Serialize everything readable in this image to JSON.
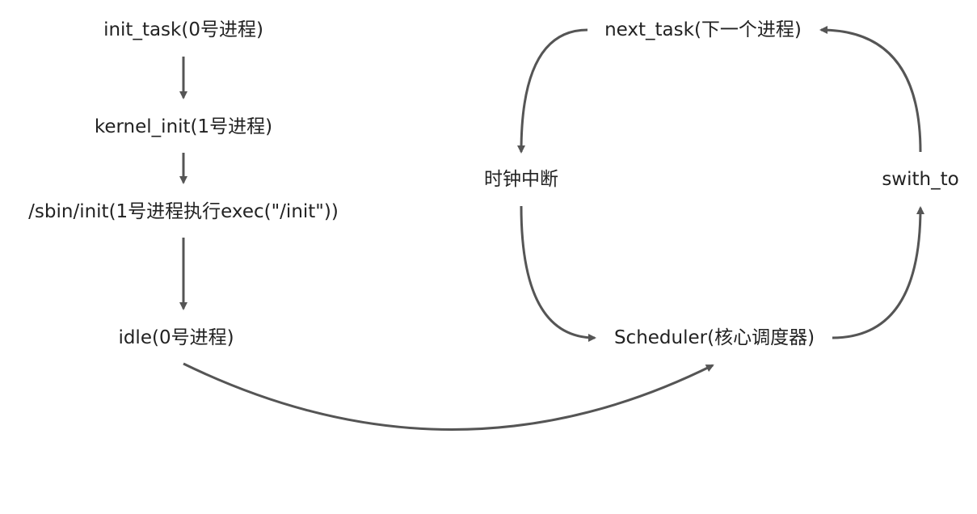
{
  "diagram": {
    "nodes": {
      "init_task": "init_task(0号进程)",
      "kernel_init": "kernel_init(1号进程)",
      "sbin_init": "/sbin/init(1号进程执行exec(\"/init\"))",
      "idle": "idle(0号进程)",
      "next_task": "next_task(下一个进程)",
      "timer_interrupt": "时钟中断",
      "scheduler": "Scheduler(核心调度器)",
      "switch_to": "swith_to"
    },
    "edges": [
      {
        "from": "init_task",
        "to": "kernel_init"
      },
      {
        "from": "kernel_init",
        "to": "sbin_init"
      },
      {
        "from": "sbin_init",
        "to": "idle"
      },
      {
        "from": "idle",
        "to": "scheduler"
      },
      {
        "from": "next_task",
        "to": "timer_interrupt"
      },
      {
        "from": "timer_interrupt",
        "to": "scheduler"
      },
      {
        "from": "scheduler",
        "to": "switch_to"
      },
      {
        "from": "switch_to",
        "to": "next_task"
      }
    ],
    "colors": {
      "arrow": "#555555",
      "text": "#222222",
      "background": "#ffffff"
    }
  }
}
